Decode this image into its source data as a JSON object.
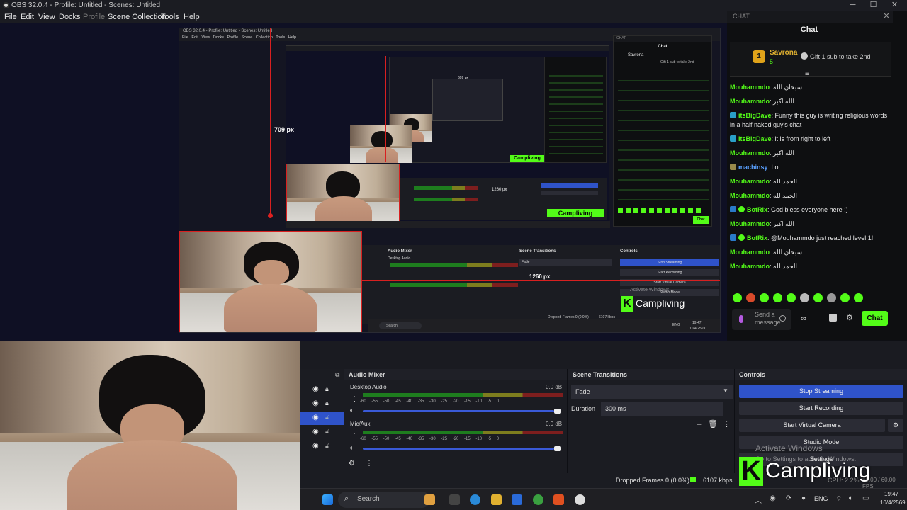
{
  "window": {
    "title": "OBS 32.0.4 - Profile: Untitled - Scenes: Untitled",
    "minimize": "─",
    "maximize": "☐",
    "close": "✕"
  },
  "menu": {
    "items": [
      "File",
      "Edit",
      "View",
      "Docks",
      "Profile",
      "Scene Collection",
      "Tools",
      "Help"
    ]
  },
  "preview": {
    "height_label": "709 px",
    "width_label": "1260 px",
    "inner_height_label": "699 px",
    "inner_width_label": "1260 px",
    "nested_title": "OBS 32.0.4 - Profile: Untitled - Scenes: Untitled",
    "nested_menu": "File Edit View Docks Profile Scene Collection Tools Help"
  },
  "chat": {
    "header": "CHAT",
    "title": "Chat",
    "pinned_user": "Savrona",
    "pinned_rank": "1",
    "pinned_count": "5",
    "gift_text": "Gift 1 sub to take 2nd",
    "messages": [
      {
        "user": "Mouhammdo",
        "text": "سبحان الله",
        "color": "green"
      },
      {
        "user": "Mouhammdo",
        "text": "الله اكبر",
        "color": "green"
      },
      {
        "user": "itsBigDave",
        "text": "Funny this guy is writing religious words in a half naked guy's chat",
        "color": "green"
      },
      {
        "user": "itsBigDave",
        "text": "it is from right to left",
        "color": "green"
      },
      {
        "user": "Mouhammdo",
        "text": "الله اكبر",
        "color": "green"
      },
      {
        "user": "machinsy",
        "text": "Lol",
        "color": "blue"
      },
      {
        "user": "Mouhammdo",
        "text": "الحمد لله",
        "color": "green"
      },
      {
        "user": "Mouhammdo",
        "text": "الحمد لله",
        "color": "green"
      },
      {
        "user": "BotRix",
        "text": "God bless everyone here :)",
        "color": "green"
      },
      {
        "user": "Mouhammdo",
        "text": "الله اكبر",
        "color": "green"
      },
      {
        "user": "BotRix",
        "text": "@Mouhammdo just reached level 1!",
        "color": "green"
      },
      {
        "user": "Mouhammdo",
        "text": "سبحان الله",
        "color": "green"
      },
      {
        "user": "Mouhammdo",
        "text": "الحمد لله",
        "color": "green"
      }
    ],
    "input_placeholder": "Send a message",
    "send_label": "Chat"
  },
  "audio_mixer": {
    "title": "Audio Mixer",
    "tracks": [
      {
        "name": "Desktop Audio",
        "db": "0.0 dB"
      },
      {
        "name": "Mic/Aux",
        "db": "0.0 dB"
      }
    ],
    "scale": "-60 -55 -50 -45 -40 -35 -30 -25 -20 -15 -10 -5 0"
  },
  "scene_transitions": {
    "title": "Scene Transitions",
    "selected": "Fade",
    "duration_label": "Duration",
    "duration_value": "300 ms"
  },
  "controls": {
    "title": "Controls",
    "stop_streaming": "Stop Streaming",
    "start_recording": "Start Recording",
    "start_virtual_camera": "Start Virtual Camera",
    "studio_mode": "Studio Mode",
    "settings": "Settings"
  },
  "status": {
    "dropped_frames": "Dropped Frames 0 (0.0%)",
    "bitrate": "6107 kbps",
    "cpu": "CPU: 2.2%",
    "fps": "60.00 / 60.00 FPS"
  },
  "overlay": {
    "brand": "Campliving",
    "brand_letter": "K",
    "activate_title": "Activate Windows",
    "activate_sub": "Go to Settings to activate Windows."
  },
  "taskbar": {
    "search_placeholder": "Search",
    "lang": "ENG",
    "time": "19:47",
    "date": "10/4/2569"
  },
  "colors": {
    "accent_blue": "#2f53c9",
    "kick_green": "#53fc18",
    "selection_red": "#d82020"
  }
}
